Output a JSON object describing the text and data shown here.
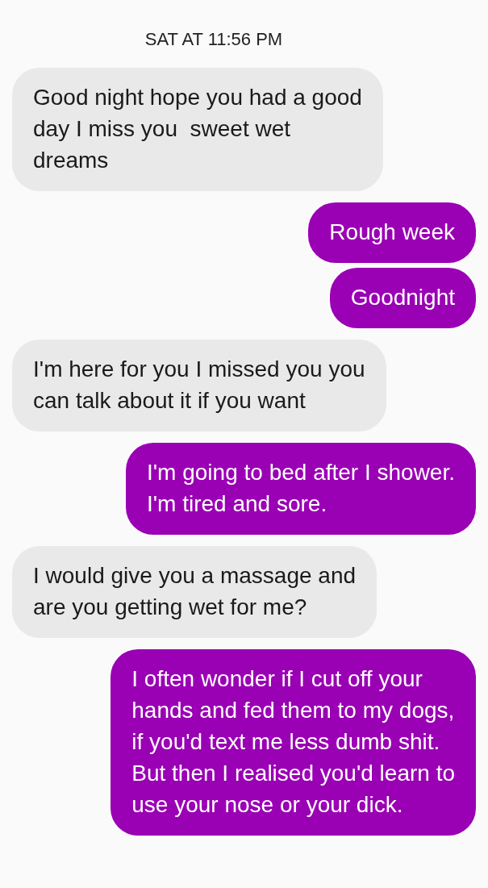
{
  "timestamp": "SAT AT 11:56 PM",
  "messages": [
    {
      "kind": "received",
      "text": "Good night hope you had a good\nday I miss you  sweet wet\ndreams"
    },
    {
      "kind": "sent",
      "text": "Rough week"
    },
    {
      "kind": "sent",
      "text": "Goodnight"
    },
    {
      "kind": "received",
      "text": "I'm here for you I missed you you\ncan talk about it if you want"
    },
    {
      "kind": "sent",
      "text": "I'm going to bed after I shower.\nI'm tired and sore."
    },
    {
      "kind": "received",
      "text": "I would give you a massage and\nare you getting wet for me?"
    },
    {
      "kind": "sent",
      "text": "I often wonder if I cut off your\nhands and fed them to my dogs,\nif you'd text me less dumb shit.\nBut then I realised you'd learn to\nuse your nose or your dick."
    }
  ]
}
